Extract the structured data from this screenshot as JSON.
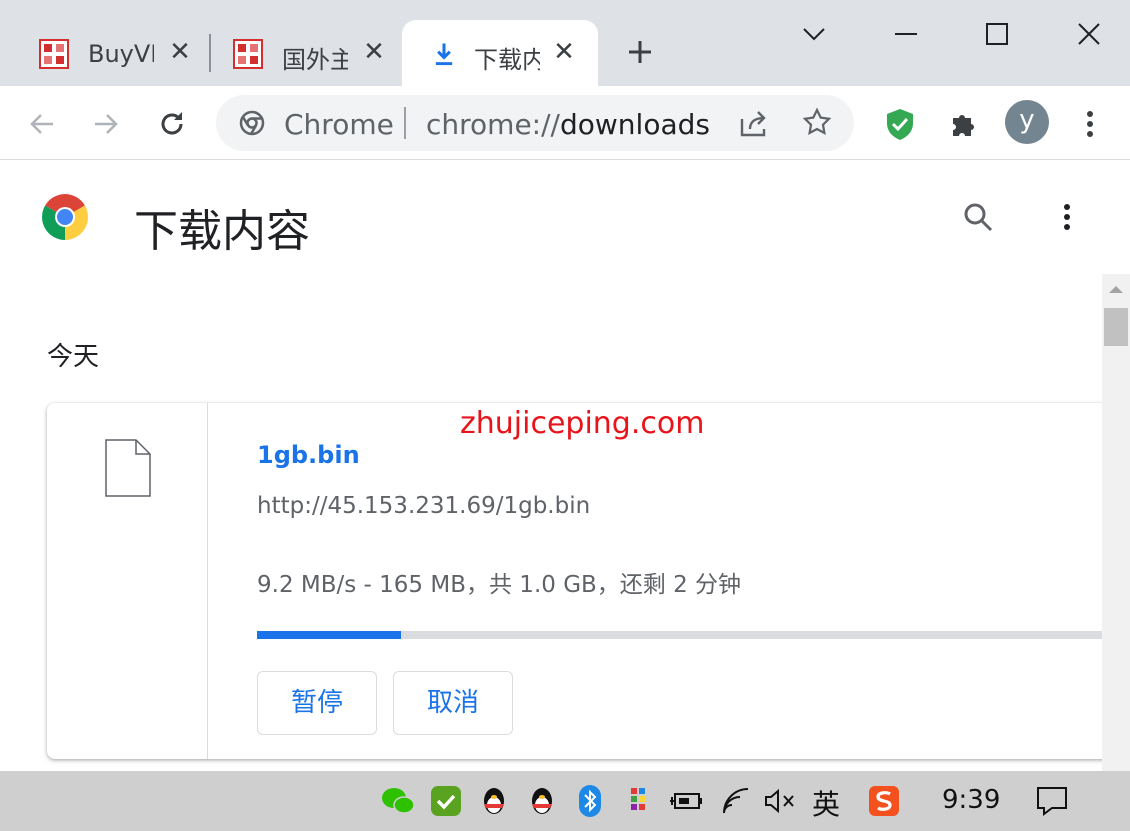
{
  "tabs": [
    {
      "title": "BuyVM",
      "favicon": "site-favicon-red",
      "active": false
    },
    {
      "title": "国外主",
      "favicon": "site-favicon-red",
      "active": false
    },
    {
      "title": "下载内",
      "favicon": "download-icon",
      "active": true
    }
  ],
  "toolbar": {
    "omnibox_site_label": "Chrome",
    "omnibox_url_scheme": "chrome://",
    "omnibox_url_host": "downloads",
    "avatar_letter": "y"
  },
  "page": {
    "title": "下载内容",
    "section_label": "今天",
    "watermark": "zhujiceping.com"
  },
  "download": {
    "file_name": "1gb.bin",
    "url": "http://45.153.231.69/1gb.bin",
    "status": "9.2 MB/s - 165 MB，共 1.0 GB，还剩 2 分钟",
    "progress": 0.165,
    "pause_label": "暂停",
    "cancel_label": "取消"
  },
  "taskbar": {
    "ime_label": "英",
    "clock": "9:39"
  },
  "colors": {
    "accent": "#1a73e8",
    "tabstrip": "#dee1e6",
    "watermark": "#e8141b",
    "shield_green": "#34a853"
  }
}
